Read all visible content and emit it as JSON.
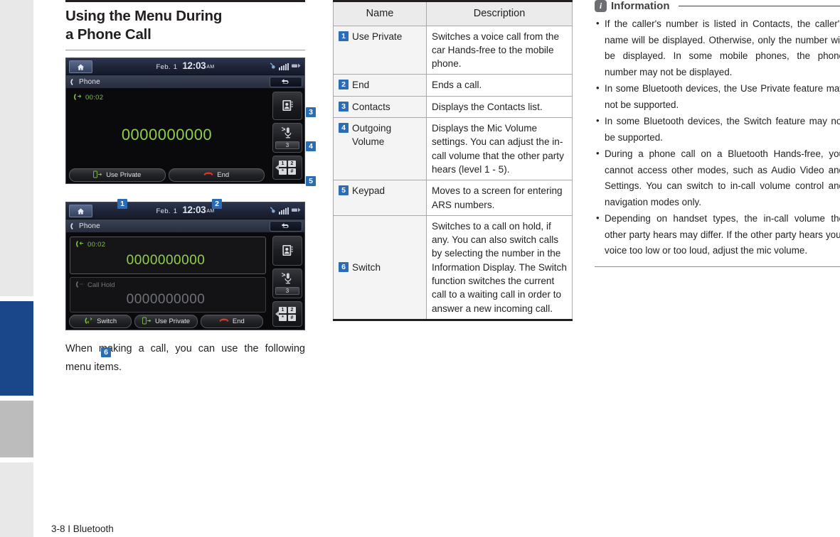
{
  "heading": {
    "line1": "Using the Menu During",
    "line2": "a Phone Call"
  },
  "body_paragraph": "When making a call, you can use the following menu items.",
  "footer": {
    "text": "3-8 I Bluetooth"
  },
  "screens": [
    {
      "name": "single-call-screen",
      "status": {
        "home_icon": "home-icon",
        "date_label": "Feb.",
        "date_number": "1",
        "time": "12:03",
        "ampm": "AM",
        "bt_icon": "bluetooth-phone-icon",
        "signal_icon": "signal-bars-icon",
        "antenna_icon": "antenna-icon"
      },
      "titlebar": {
        "title": "Phone",
        "phone_icon": "phone-handset-icon",
        "back_icon": "back-arrow-icon"
      },
      "call": {
        "direction_icon": "outgoing-call-icon",
        "duration": "00:02",
        "number": "0000000000"
      },
      "side_buttons": [
        {
          "name": "Contacts",
          "icon": "contacts-book-icon",
          "callout": "3"
        },
        {
          "name": "Outgoing Volume",
          "icon": "mic-mute-icon",
          "level": "3",
          "callout": "4"
        },
        {
          "name": "Keypad",
          "icon": "keypad-icon",
          "keys": [
            "1",
            "2",
            "*",
            "#"
          ],
          "callout": "5"
        }
      ],
      "bottom_buttons": [
        {
          "label": "Use Private",
          "icon": "use-private-icon",
          "callout": "1"
        },
        {
          "label": "End",
          "icon": "end-call-icon",
          "callout": "2"
        }
      ]
    },
    {
      "name": "call-hold-screen",
      "status": {
        "home_icon": "home-icon",
        "date_label": "Feb.",
        "date_number": "1",
        "time": "12:03",
        "ampm": "AM",
        "bt_icon": "bluetooth-phone-icon",
        "signal_icon": "signal-bars-icon",
        "antenna_icon": "antenna-icon"
      },
      "titlebar": {
        "title": "Phone",
        "phone_icon": "phone-handset-icon",
        "back_icon": "back-arrow-icon"
      },
      "active_call": {
        "direction_icon": "incoming-call-icon",
        "duration": "00:02",
        "number": "0000000000"
      },
      "held_call": {
        "direction_icon": "hold-call-icon",
        "label": "Call Hold",
        "number": "0000000000"
      },
      "side_buttons": [
        {
          "name": "Contacts",
          "icon": "contacts-book-icon"
        },
        {
          "name": "Outgoing Volume",
          "icon": "mic-mute-icon",
          "level": "3"
        },
        {
          "name": "Keypad",
          "icon": "keypad-icon",
          "keys": [
            "1",
            "2",
            "*",
            "#"
          ]
        }
      ],
      "bottom_buttons": [
        {
          "label": "Switch",
          "icon": "switch-call-icon",
          "callout": "6"
        },
        {
          "label": "Use Private",
          "icon": "use-private-icon"
        },
        {
          "label": "End",
          "icon": "end-call-icon"
        }
      ]
    }
  ],
  "table": {
    "headers": {
      "name": "Name",
      "description": "Description"
    },
    "rows": [
      {
        "num": "1",
        "name": "Use Private",
        "name_cont": "",
        "desc": "Switches a voice call from the car Hands-free to the mobile phone."
      },
      {
        "num": "2",
        "name": "End",
        "name_cont": "",
        "desc": "Ends a call."
      },
      {
        "num": "3",
        "name": "Contacts",
        "name_cont": "",
        "desc": "Displays the Contacts list."
      },
      {
        "num": "4",
        "name": "Outgoing",
        "name_cont": "Volume",
        "desc": "Displays the Mic Volume settings. You can adjust the in-call volume that the other party hears (level 1 - 5)."
      },
      {
        "num": "5",
        "name": "Keypad",
        "name_cont": "",
        "desc": "Moves to a screen for entering ARS numbers."
      },
      {
        "num": "6",
        "name": "Switch",
        "name_cont": "",
        "desc": "Switches to a call on hold, if any. You can also switch calls by selecting the number in the Information Display. The Switch function switches the current call to a waiting call in order to answer a new incoming call."
      }
    ]
  },
  "information": {
    "icon": "info-icon",
    "title": "Information",
    "items": [
      "If the caller's number is listed in Contacts, the caller's name will be displayed. Otherwise, only the number will be displayed. In some mobile phones, the phone number may not be displayed.",
      "In some Bluetooth devices, the Use Private feature may not be supported.",
      "In some Bluetooth devices, the Switch feature may not be supported.",
      "During a phone call on a Bluetooth Hands-free, you cannot access other modes, such as Audio Video and Settings. You can switch to in-call volume control and navigation modes only.",
      "Depending on handset types, the in-call volume the other party hears may differ. If the other party hears your voice too low or too loud, adjust the mic volume."
    ]
  },
  "colors": {
    "accent_blue": "#2a6cb6",
    "tab_blue": "#1a468a",
    "call_green": "#8fd04b",
    "end_red": "#c0392b"
  }
}
